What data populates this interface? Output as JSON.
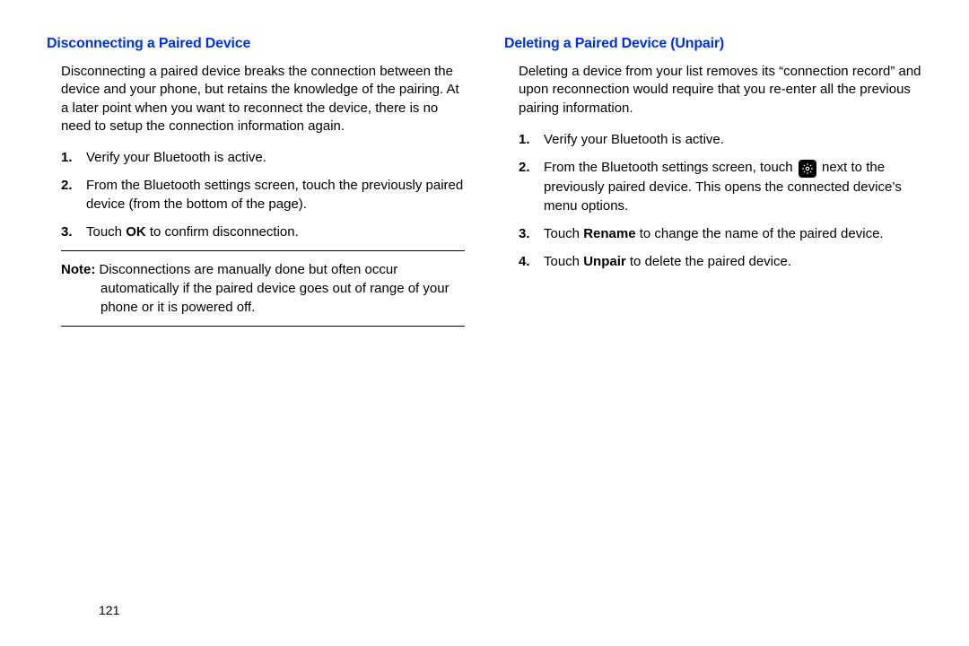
{
  "left": {
    "heading": "Disconnecting a Paired Device",
    "intro": "Disconnecting a paired device breaks the connection between the device and your phone, but retains the knowledge of the pairing. At a later point when you want to reconnect the device, there is no need to setup the connection information again.",
    "step1": "Verify your Bluetooth is active.",
    "step2": "From the Bluetooth settings screen, touch the previously paired device (from the bottom of the page).",
    "step3_pre": "Touch ",
    "step3_bold": "OK",
    "step3_post": " to confirm disconnection.",
    "note_label": "Note:",
    "note_text": " Disconnections are manually done but often occur automatically if the paired device goes out of range of your phone or it is powered off."
  },
  "right": {
    "heading": "Deleting a Paired Device (Unpair)",
    "intro": "Deleting a device from your list removes its “connection record” and upon reconnection would require that you re-enter all the previous pairing information.",
    "step1": "Verify your Bluetooth is active.",
    "step2_pre": "From the Bluetooth settings screen, touch ",
    "step2_post": " next to the previously paired device. This opens the connected device’s menu options.",
    "step3_pre": "Touch ",
    "step3_bold": "Rename",
    "step3_post": " to change the name of the paired device.",
    "step4_pre": "Touch ",
    "step4_bold": "Unpair",
    "step4_post": " to delete the paired device."
  },
  "page_number": "121"
}
